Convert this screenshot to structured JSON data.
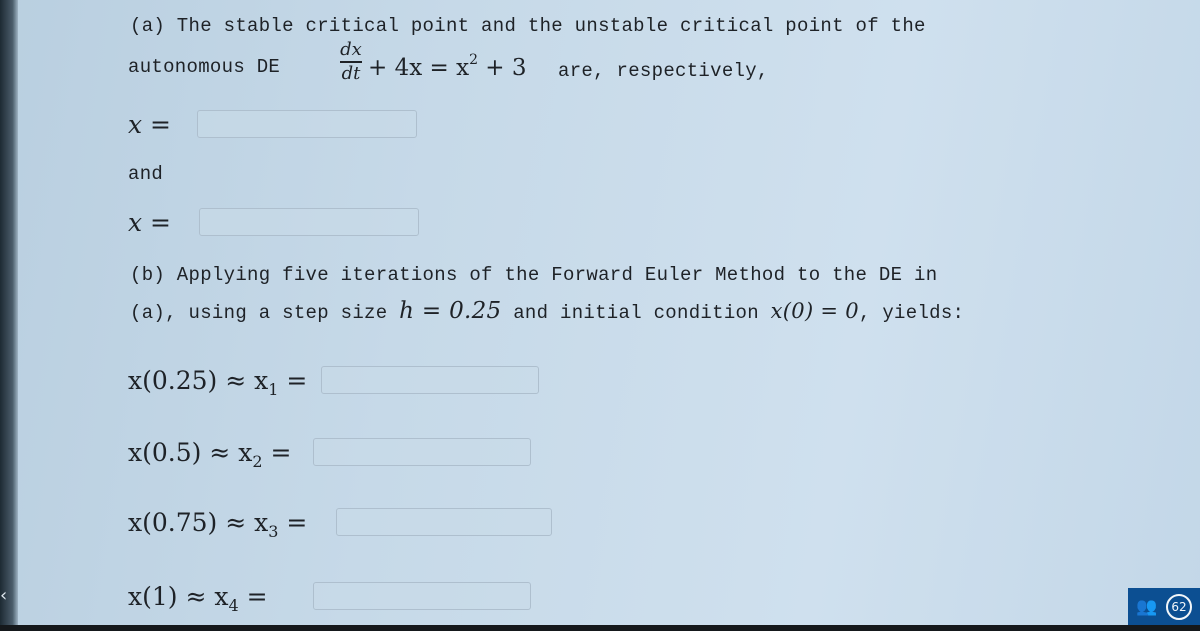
{
  "part_a": {
    "line1": "(a) The stable critical point and the unstable critical point of the",
    "line2_prefix": "autonomous DE",
    "equation": {
      "fraction_numerator": "dx",
      "fraction_denominator": "dt",
      "rest_before_sup": "+ 4x = x",
      "superscript": "2",
      "rest_after_sup": " + 3"
    },
    "line2_suffix": "are, respectively,",
    "stable_label": "x =",
    "stable_value": "",
    "connector": "and",
    "unstable_label": "x =",
    "unstable_value": ""
  },
  "part_b": {
    "line1": "(b) Applying five iterations of the Forward Euler Method to the DE in",
    "line2_a": "(a), using a step size",
    "step_math": "h = 0.25",
    "line2_b": "and initial condition",
    "ic_math": "x(0) = 0",
    "line2_c": ", yields:",
    "rows": [
      {
        "lhs": "x(0.25) ≈ x",
        "sub": "1",
        "eq": " =",
        "value": ""
      },
      {
        "lhs": "x(0.5) ≈ x",
        "sub": "2",
        "eq": " =",
        "value": ""
      },
      {
        "lhs": "x(0.75) ≈ x",
        "sub": "3",
        "eq": " =",
        "value": ""
      },
      {
        "lhs": "x(1) ≈ x",
        "sub": "4",
        "eq": " =",
        "value": ""
      }
    ]
  },
  "badge": {
    "icon": "people-icon",
    "count": "62"
  },
  "nav": {
    "back_icon": "chevron-left-icon",
    "back_glyph": "‹"
  }
}
